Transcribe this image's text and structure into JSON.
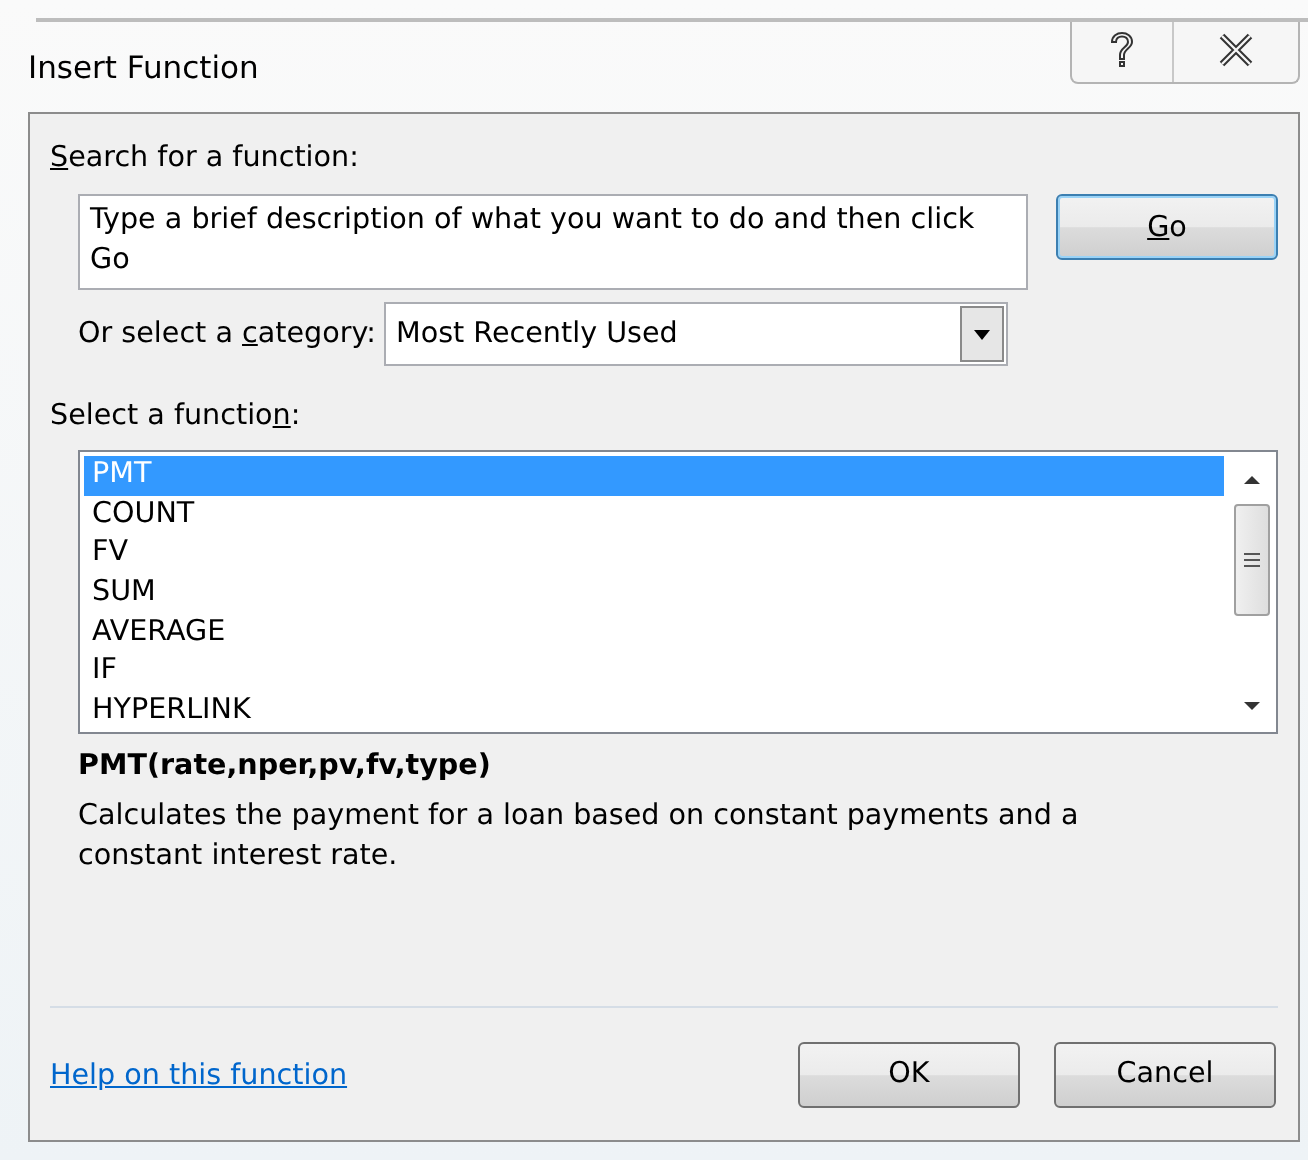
{
  "window": {
    "title": "Insert Function"
  },
  "search": {
    "label": {
      "key": "S",
      "after": "earch for a function:"
    },
    "value": "Type a brief description of what you want to do and then click Go",
    "go_button": {
      "key": "G",
      "after": "o"
    }
  },
  "category": {
    "label": {
      "before": "Or select a ",
      "key": "c",
      "after": "ategory:"
    },
    "value": "Most Recently Used"
  },
  "functions": {
    "label": {
      "before": "Select a functio",
      "key": "n",
      "after": ":"
    },
    "items": [
      {
        "name": "PMT",
        "selected": true
      },
      {
        "name": "COUNT",
        "selected": false
      },
      {
        "name": "FV",
        "selected": false
      },
      {
        "name": "SUM",
        "selected": false
      },
      {
        "name": "AVERAGE",
        "selected": false
      },
      {
        "name": "IF",
        "selected": false
      },
      {
        "name": "HYPERLINK",
        "selected": false
      }
    ]
  },
  "signature": "PMT(rate,nper,pv,fv,type)",
  "description": "Calculates the payment for a loan based on constant payments and a constant interest rate.",
  "help_link": "Help on this function",
  "buttons": [
    "OK",
    "Cancel"
  ]
}
